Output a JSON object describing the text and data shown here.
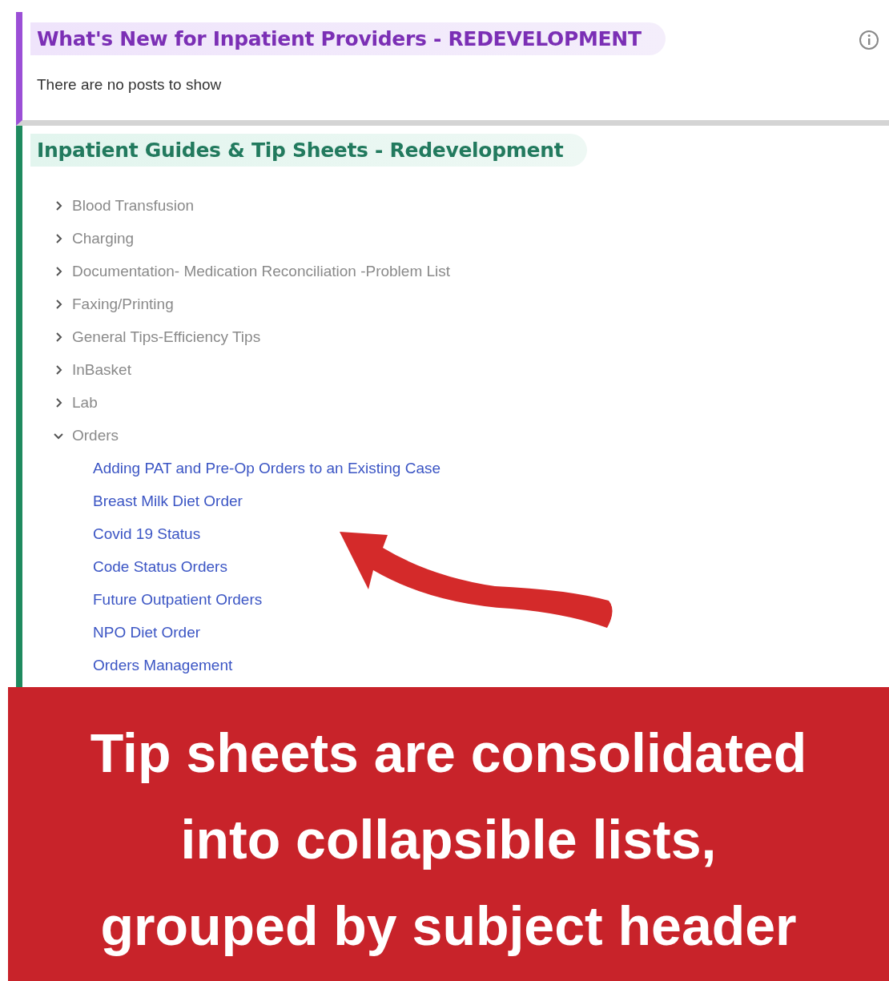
{
  "news_section": {
    "title": "What's New for Inpatient Providers - REDEVELOPMENT",
    "message": "There are no posts to show"
  },
  "guides_section": {
    "title": "Inpatient Guides & Tip Sheets - Redevelopment",
    "categories": [
      {
        "label": "Blood Transfusion",
        "expanded": false
      },
      {
        "label": "Charging",
        "expanded": false
      },
      {
        "label": "Documentation- Medication Reconciliation -Problem List",
        "expanded": false
      },
      {
        "label": "Faxing/Printing",
        "expanded": false
      },
      {
        "label": "General Tips-Efficiency Tips",
        "expanded": false
      },
      {
        "label": "InBasket",
        "expanded": false
      },
      {
        "label": "Lab",
        "expanded": false
      },
      {
        "label": "Orders",
        "expanded": true,
        "children": [
          {
            "label": "Adding PAT and Pre-Op Orders to an Existing Case"
          },
          {
            "label": "Breast Milk Diet Order"
          },
          {
            "label": "Covid 19 Status"
          },
          {
            "label": "Code Status Orders"
          },
          {
            "label": "Future Outpatient Orders"
          },
          {
            "label": "NPO Diet Order"
          },
          {
            "label": "Orders Management"
          }
        ]
      }
    ]
  },
  "caption": {
    "lines": [
      "Tip sheets are consolidated",
      "into collapsible lists,",
      "grouped by subject header"
    ]
  }
}
